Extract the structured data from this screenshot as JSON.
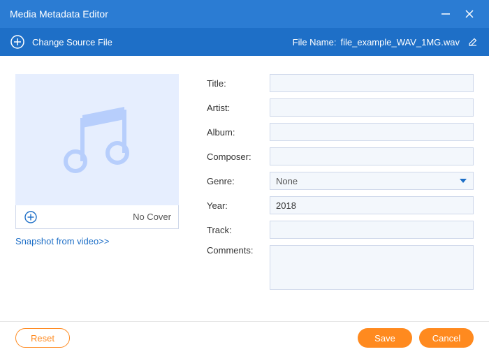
{
  "app": {
    "title": "Media Metadata Editor"
  },
  "toolbar": {
    "change_source": "Change Source File",
    "file_name_label": "File Name:",
    "file_name_value": "file_example_WAV_1MG.wav"
  },
  "cover": {
    "no_cover_label": "No Cover",
    "snapshot_link": "Snapshot from video>>"
  },
  "fields": {
    "title": {
      "label": "Title:",
      "value": ""
    },
    "artist": {
      "label": "Artist:",
      "value": ""
    },
    "album": {
      "label": "Album:",
      "value": ""
    },
    "composer": {
      "label": "Composer:",
      "value": ""
    },
    "genre": {
      "label": "Genre:",
      "value": "None"
    },
    "year": {
      "label": "Year:",
      "value": "2018"
    },
    "track": {
      "label": "Track:",
      "value": ""
    },
    "comments": {
      "label": "Comments:",
      "value": ""
    }
  },
  "buttons": {
    "reset": "Reset",
    "save": "Save",
    "cancel": "Cancel"
  },
  "colors": {
    "header": "#2b7cd3",
    "toolbar": "#1e6fc7",
    "accent": "#ff8a1f",
    "cover_bg": "#e6eefe"
  }
}
